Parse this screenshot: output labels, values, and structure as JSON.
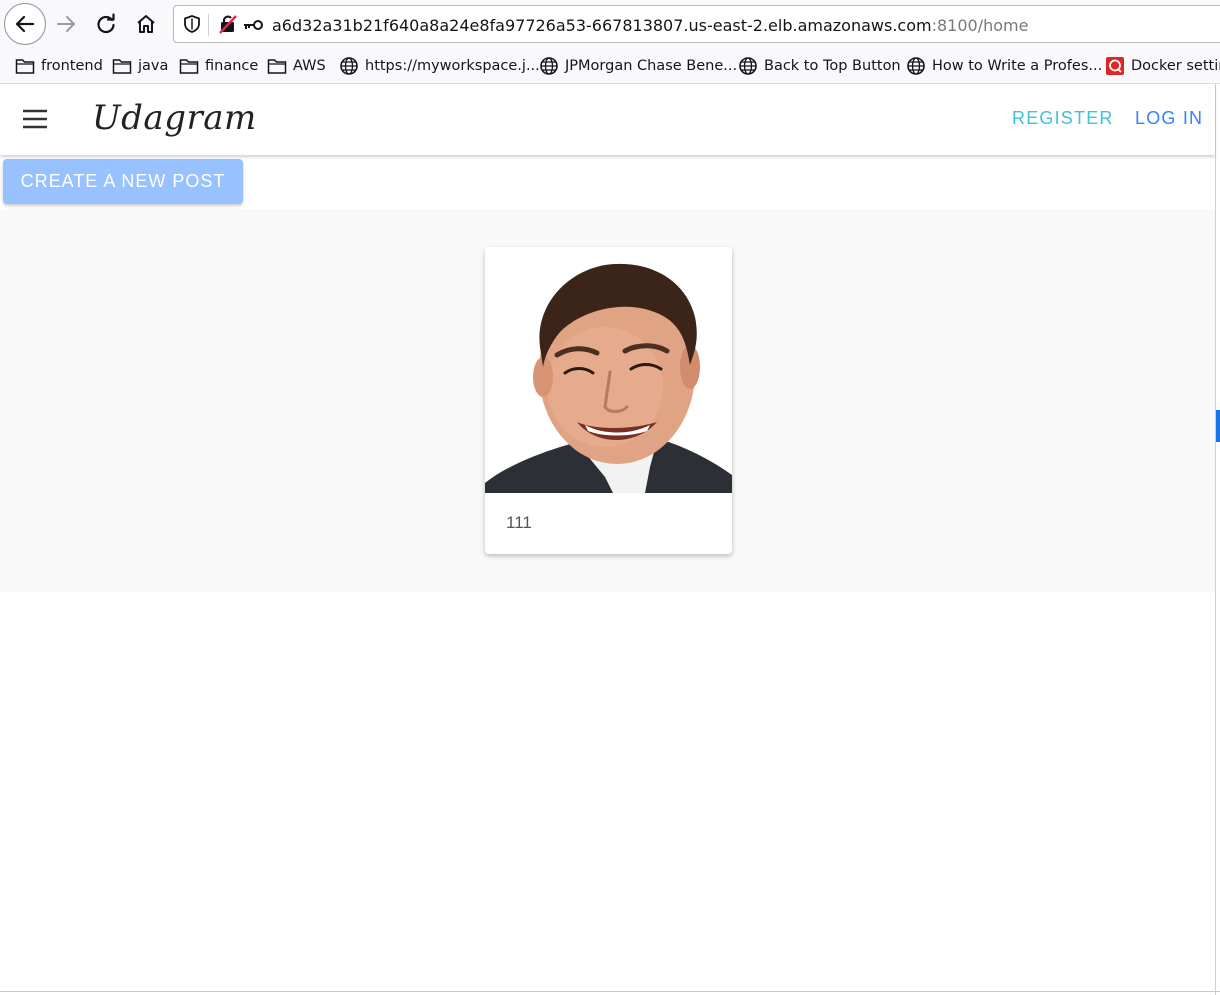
{
  "browser": {
    "url_main": "a6d32a31b21f640a8a24e8fa97726a53-667813807.us-east-2.elb.amazonaws.com",
    "url_rest": ":8100/home",
    "bookmarks": [
      {
        "label": "frontend",
        "icon": "folder-icon"
      },
      {
        "label": "java",
        "icon": "folder-icon"
      },
      {
        "label": "finance",
        "icon": "folder-icon"
      },
      {
        "label": "AWS",
        "icon": "folder-icon"
      },
      {
        "label": "https://myworkspace.j...",
        "icon": "globe-icon"
      },
      {
        "label": "JPMorgan Chase Bene...",
        "icon": "globe-icon"
      },
      {
        "label": "Back to Top Button",
        "icon": "globe-icon"
      },
      {
        "label": "How to Write a Profes...",
        "icon": "globe-icon"
      },
      {
        "label": "Docker settin",
        "icon": "docker-icon"
      }
    ]
  },
  "app": {
    "brand": "Udagram",
    "register_label": "REGISTER",
    "login_label": "LOG IN",
    "create_post_label": "CREATE A NEW POST",
    "colors": {
      "register": "#3dc2d8",
      "login": "#3880ff",
      "create_button": "#98c1ff"
    }
  },
  "feed": {
    "items": [
      {
        "caption": "111",
        "image": "portrait-photo"
      }
    ]
  }
}
